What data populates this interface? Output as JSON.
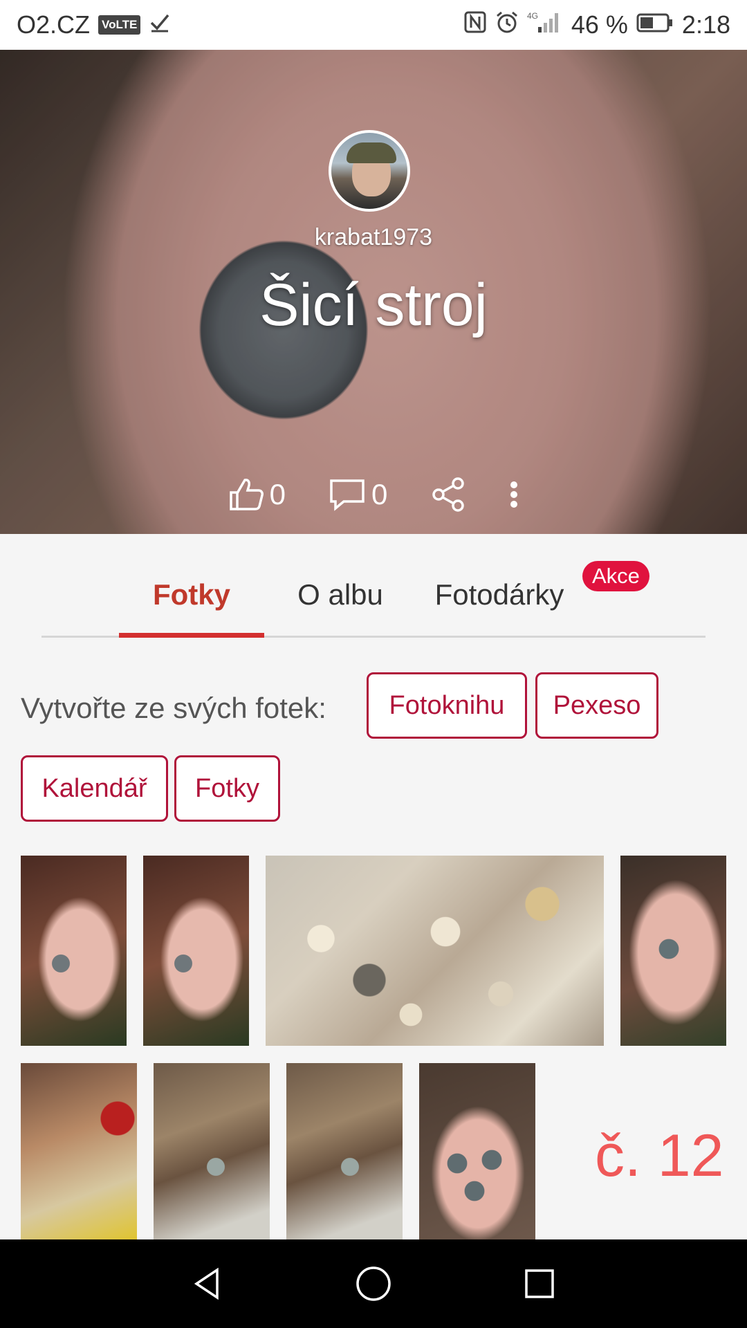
{
  "status_bar": {
    "carrier": "O2.CZ",
    "volte": "VoLTE",
    "network": "4G",
    "battery": "46 %",
    "time": "2:18",
    "icons": [
      "volte-icon",
      "check-icon",
      "nfc-icon",
      "alarm-icon",
      "signal-icon",
      "battery-icon"
    ]
  },
  "album": {
    "username": "krabat1973",
    "title": "Šicí stroj",
    "likes": "0",
    "comments": "0"
  },
  "tabs": [
    {
      "label": "Fotky"
    },
    {
      "label": "O albu"
    },
    {
      "label": "Fotodárky"
    }
  ],
  "badge": "Akce",
  "create": {
    "label": "Vytvořte ze svých fotek:",
    "options": [
      "Fotoknihu",
      "Pexeso",
      "Kalendář",
      "Fotky"
    ]
  },
  "gallery": {
    "count_label": "č. 12"
  },
  "colors": {
    "accent": "#c0392b",
    "chip_border": "#b0133a",
    "badge": "#e0123e",
    "overlay_number": "#ef4b4b"
  },
  "nav_bar": {
    "icons": [
      "back-icon",
      "home-icon",
      "recents-icon"
    ]
  }
}
